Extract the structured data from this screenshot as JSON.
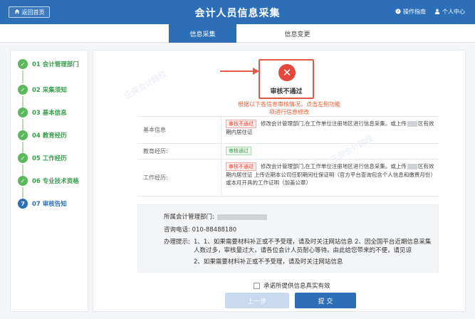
{
  "header": {
    "back_label": "返回首页",
    "title": "会计人员信息采集",
    "guide_label": "操作指南",
    "user_center_label": "个人中心"
  },
  "tabs": [
    {
      "label": "信息采集",
      "active": true
    },
    {
      "label": "信息变更",
      "active": false
    }
  ],
  "steps": [
    {
      "label": "01 会计管理部门",
      "num": "✓",
      "status": "done"
    },
    {
      "label": "02 采集须知",
      "num": "✓",
      "status": "done"
    },
    {
      "label": "03 基本信息",
      "num": "✓",
      "status": "done"
    },
    {
      "label": "04 教育经历",
      "num": "✓",
      "status": "done"
    },
    {
      "label": "05 工作经历",
      "num": "✓",
      "status": "done"
    },
    {
      "label": "06 专业技术资格",
      "num": "✓",
      "status": "done"
    },
    {
      "label": "07 审核告知",
      "num": "7",
      "status": "current"
    }
  ],
  "result": {
    "status_text": "审核不通过",
    "hint": "根据以下各信息审核情况，点击左侧功能项进行信息修改"
  },
  "review_rows": [
    {
      "label": "基本信息",
      "tag": "审核不通过",
      "tag_type": "fail",
      "text_a": "修改会计管理部门,在工作单位注册地区进行信息采集。或上传",
      "text_b": "区有效期内居住证"
    },
    {
      "label": "教育经历:",
      "tag": "审核通过",
      "tag_type": "pass",
      "text_a": "",
      "text_b": ""
    },
    {
      "label": "工作经历:",
      "tag": "审核不通过",
      "tag_type": "fail",
      "text_a": "修改会计管理部门,在工作单位注册地区进行信息采集。或上传",
      "text_b": "区有效期内居住证 上传近期本公司任职期间社保证明（官方平台查询包含个人信息和缴费月份）或本月开具的工作证明（加盖公章）"
    }
  ],
  "contact": {
    "dept_label": "所属会计管理部门:",
    "phone_label": "咨询电话:",
    "phone_value": "010-88488180",
    "tips_label": "办理提示:",
    "tips_1": "1、1、如果需要材料补正或不予受理，请及时关注网站信息 2、因全国平台近期信息采集人数过多，审核量过大，请各位会计人员耐心等待。由此给您带来的不便，请见谅",
    "tips_2": "2、如果需要材料补正或不予受理，请及时关注网站信息"
  },
  "agree_label": "承诺所提供信息真实有效",
  "buttons": {
    "prev_label": "上一步",
    "submit_label": "提 交"
  },
  "colors": {
    "brand": "#2c6fb8",
    "fail": "#e5483a",
    "pass": "#3a9b4f"
  }
}
